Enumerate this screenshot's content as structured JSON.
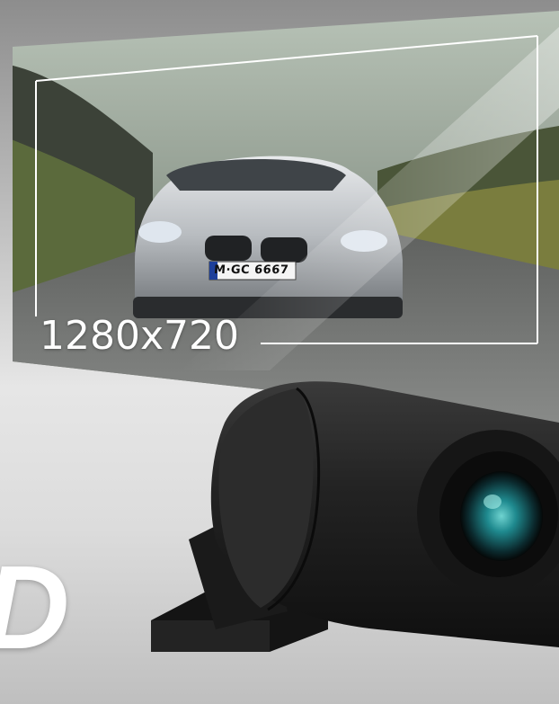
{
  "resolution_label": "1280x720",
  "plate_text": "M·GC 6667",
  "corner_letter": "D",
  "colors": {
    "background": "#d9d9d9",
    "frame_line": "#ffffff",
    "camera_body": "#1e1e1e",
    "lens_tint": "#1f8a8f"
  }
}
